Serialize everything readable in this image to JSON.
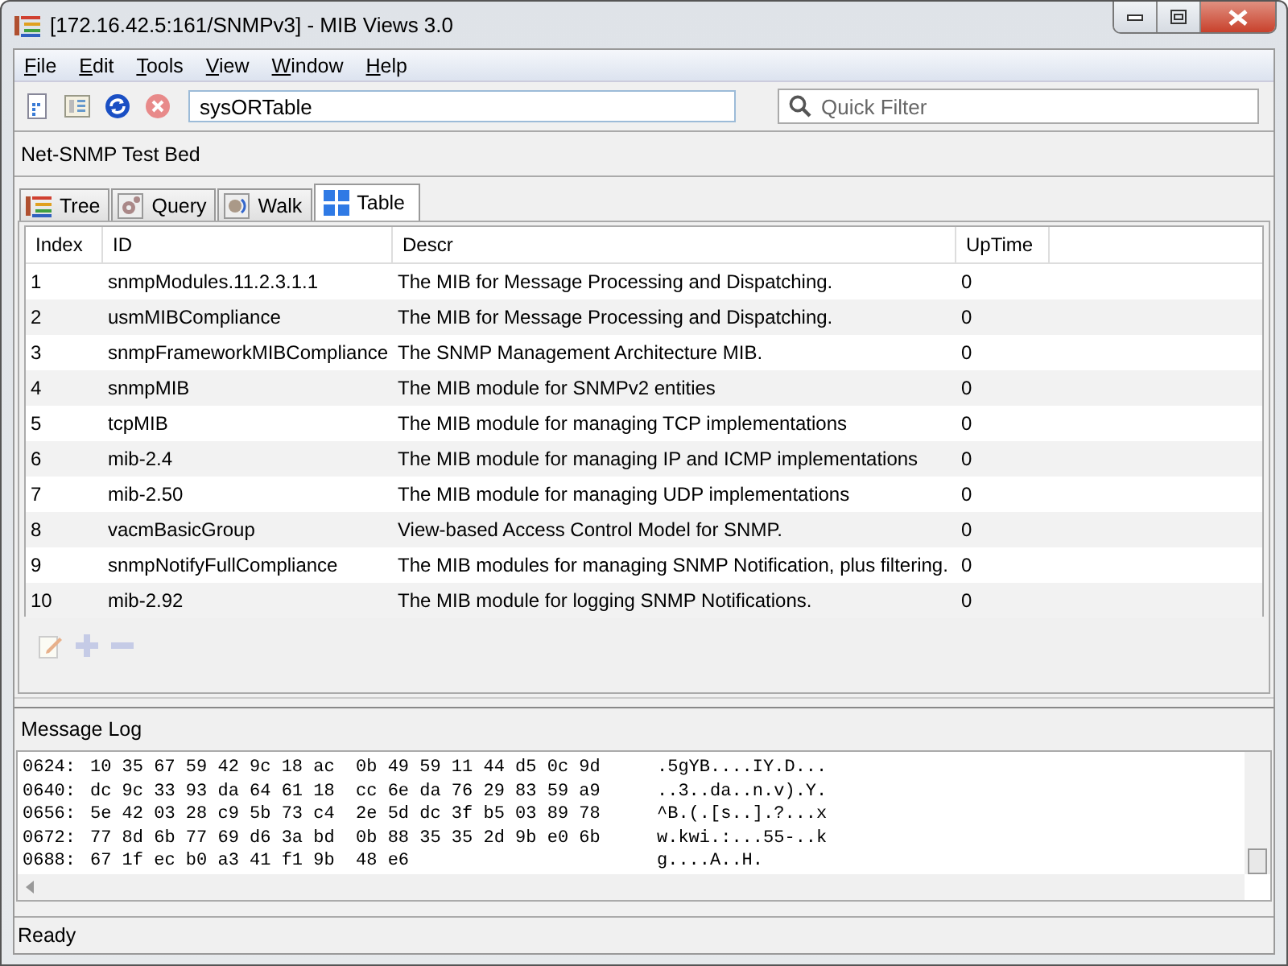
{
  "window": {
    "title": "[172.16.42.5:161/SNMPv3] - MIB Views 3.0"
  },
  "menu": [
    "File",
    "Edit",
    "Tools",
    "View",
    "Window",
    "Help"
  ],
  "toolbar": {
    "oid": "sysORTable",
    "filter_placeholder": "Quick Filter"
  },
  "agent": "Net-SNMP Test Bed",
  "tabs": [
    {
      "label": "Tree",
      "selected": false
    },
    {
      "label": "Query",
      "selected": false
    },
    {
      "label": "Walk",
      "selected": false
    },
    {
      "label": "Table",
      "selected": true
    }
  ],
  "table": {
    "columns": [
      "Index",
      "ID",
      "Descr",
      "UpTime"
    ],
    "rows": [
      [
        "1",
        "snmpModules.11.2.3.1.1",
        "The MIB for Message Processing and Dispatching.",
        "0"
      ],
      [
        "2",
        "usmMIBCompliance",
        "The MIB for Message Processing and Dispatching.",
        "0"
      ],
      [
        "3",
        "snmpFrameworkMIBCompliance",
        "The SNMP Management Architecture MIB.",
        "0"
      ],
      [
        "4",
        "snmpMIB",
        "The MIB module for SNMPv2 entities",
        "0"
      ],
      [
        "5",
        "tcpMIB",
        "The MIB module for managing TCP implementations",
        "0"
      ],
      [
        "6",
        "mib-2.4",
        "The MIB module for managing IP and ICMP implementations",
        "0"
      ],
      [
        "7",
        "mib-2.50",
        "The MIB module for managing UDP implementations",
        "0"
      ],
      [
        "8",
        "vacmBasicGroup",
        "View-based Access Control Model for SNMP.",
        "0"
      ],
      [
        "9",
        "snmpNotifyFullCompliance",
        "The MIB modules for managing SNMP Notification, plus filtering.",
        "0"
      ],
      [
        "10",
        "mib-2.92",
        "The MIB module for logging SNMP Notifications.",
        "0"
      ]
    ]
  },
  "message_log": {
    "title": "Message Log",
    "lines": [
      {
        "offset": "0624:",
        "hex": "10 35 67 59 42 9c 18 ac  0b 49 59 11 44 d5 0c 9d",
        "ascii": ".5gYB....IY.D..."
      },
      {
        "offset": "0640:",
        "hex": "dc 9c 33 93 da 64 61 18  cc 6e da 76 29 83 59 a9",
        "ascii": "..3..da..n.v).Y."
      },
      {
        "offset": "0656:",
        "hex": "5e 42 03 28 c9 5b 73 c4  2e 5d dc 3f b5 03 89 78",
        "ascii": "^B.(.[s..].?...x"
      },
      {
        "offset": "0672:",
        "hex": "77 8d 6b 77 69 d6 3a bd  0b 88 35 35 2d 9b e0 6b",
        "ascii": "w.kwi.:...55-..k"
      },
      {
        "offset": "0688:",
        "hex": "67 1f ec b0 a3 41 f1 9b  48 e6",
        "ascii": "g....A..H."
      }
    ]
  },
  "status_bar": "Ready"
}
